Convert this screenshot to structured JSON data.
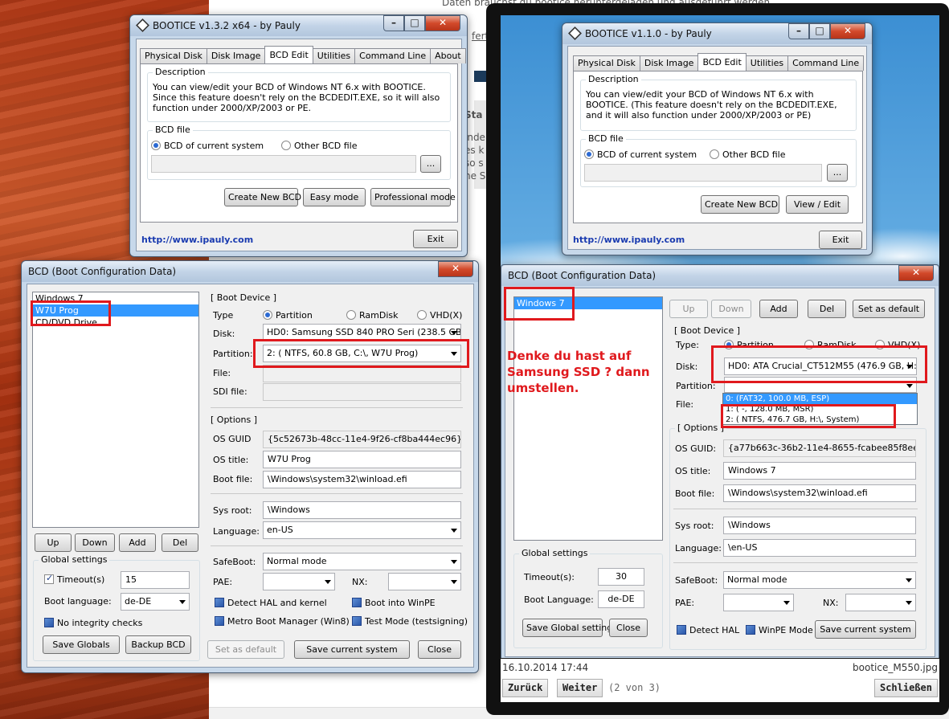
{
  "background": {
    "fragments": [
      "Daten brauchst du bootice heruntergeladen und ausgeführt werden",
      "fert",
      "Sta",
      "inde",
      "es k",
      "so s",
      "he S"
    ]
  },
  "bootice_left": {
    "title": "BOOTICE v1.3.2 x64 - by Pauly",
    "tabs": [
      "Physical Disk",
      "Disk Image",
      "BCD Edit",
      "Utilities",
      "Command Line",
      "About"
    ],
    "active_tab": "BCD Edit",
    "description_label": "Description",
    "description": "You can view/edit your BCD of Windows NT 6.x with BOOTICE. Since this feature doesn't rely on the BCDEDIT.EXE, so it will also function under 2000/XP/2003 or PE.",
    "bcd_file_label": "BCD file",
    "radio_current": "BCD of current system",
    "radio_other": "Other BCD file",
    "browse": "...",
    "buttons": [
      "Create New BCD",
      "Easy mode",
      "Professional mode"
    ],
    "link": "http://www.ipauly.com",
    "exit": "Exit"
  },
  "bcd_left": {
    "title": "BCD (Boot Configuration Data)",
    "entries": [
      "Windows 7",
      "W7U Prog",
      "CD/DVD Drive"
    ],
    "selected_entry": "W7U Prog",
    "list_buttons": [
      "Up",
      "Down",
      "Add",
      "Del"
    ],
    "global_label": "Global settings",
    "timeout_label": "Timeout(s)",
    "timeout_value": "15",
    "boot_language_label": "Boot language:",
    "boot_language_value": "de-DE",
    "no_integrity": "No integrity checks",
    "save_globals": "Save Globals",
    "backup_bcd": "Backup BCD",
    "boot_device_label": "[ Boot Device ]",
    "type_label": "Type",
    "type_partition": "Partition",
    "type_ramdisk": "RamDisk",
    "type_vhd": "VHD(X)",
    "disk_label": "Disk:",
    "disk_value": "HD0: Samsung SSD 840 PRO Seri (238.5 GB, C",
    "partition_label": "Partition:",
    "partition_value": "2: ( NTFS,  60.8 GB, C:\\, W7U Prog)",
    "file_label": "File:",
    "sdi_label": "SDI file:",
    "options_label": "[ Options ]",
    "os_guid_label": "OS GUID",
    "os_guid_value": "{5c52673b-48cc-11e4-9f26-cf8ba444ec96}",
    "os_title_label": "OS title:",
    "os_title_value": "W7U Prog",
    "boot_file_label": "Boot file:",
    "boot_file_value": "\\Windows\\system32\\winload.efi",
    "sys_root_label": "Sys root:",
    "sys_root_value": "\\Windows",
    "language_label": "Language:",
    "language_value": "en-US",
    "safeboot_label": "SafeBoot:",
    "safeboot_value": "Normal mode",
    "pae_label": "PAE:",
    "nx_label": "NX:",
    "detect_hal": "Detect HAL and kernel",
    "boot_winpe": "Boot into WinPE",
    "metro_boot": "Metro Boot Manager (Win8)",
    "test_mode": "Test Mode (testsigning)",
    "set_default": "Set as default",
    "save_current": "Save current system",
    "close": "Close"
  },
  "viewer": {
    "bootice_right": {
      "title": "BOOTICE v1.1.0 - by Pauly",
      "tabs": [
        "Physical Disk",
        "Disk Image",
        "BCD Edit",
        "Utilities",
        "Command Line"
      ],
      "active_tab": "BCD Edit",
      "description_label": "Description",
      "description": "You can view/edit your BCD of Windows NT 6.x with BOOTICE. (This feature doesn't rely on the BCDEDIT.EXE, and it will also function under 2000/XP/2003 or PE)",
      "bcd_file_label": "BCD file",
      "radio_current": "BCD of current system",
      "radio_other": "Other BCD file",
      "browse": "...",
      "buttons": [
        "Create New BCD",
        "View / Edit"
      ],
      "link": "http://www.ipauly.com",
      "exit": "Exit"
    },
    "bcd_right": {
      "title": "BCD (Boot Configuration Data)",
      "entries": [
        "Windows 7"
      ],
      "selected_entry": "Windows 7",
      "top_buttons": [
        "Up",
        "Down",
        "Add",
        "Del",
        "Set as default"
      ],
      "boot_device_label": "[ Boot Device ]",
      "type_label": "Type:",
      "type_partition": "Partition",
      "type_ramdisk": "RamDisk",
      "type_vhd": "VHD(X)",
      "disk_label": "Disk:",
      "disk_value": "HD0: ATA Crucial_CT512M55 (476.9 GB, H:)",
      "partition_label": "Partition:",
      "partition_options": [
        "0: (FAT32, 100.0 MB, ESP)",
        "1: ( -, 128.0 MB, MSR)",
        "2: ( NTFS, 476.7 GB, H:\\, System)"
      ],
      "file_label": "File:",
      "options_label": "[ Options ]",
      "os_guid_label": "OS GUID:",
      "os_guid_value": "{a77b663c-36b2-11e4-8655-fcabee85f8ee}",
      "os_title_label": "OS title:",
      "os_title_value": "Windows 7",
      "boot_file_label": "Boot file:",
      "boot_file_value": "\\Windows\\system32\\winload.efi",
      "sys_root_label": "Sys root:",
      "sys_root_value": "\\Windows",
      "language_label": "Language:",
      "language_value": "\\en-US",
      "safeboot_label": "SafeBoot:",
      "safeboot_value": "Normal mode",
      "pae_label": "PAE:",
      "nx_label": "NX:",
      "global_label": "Global settings",
      "timeout_label": "Timeout(s):",
      "timeout_value": "30",
      "boot_language_label": "Boot Language:",
      "boot_language_value": "de-DE",
      "save_global": "Save Global settings",
      "close": "Close",
      "detect_hal": "Detect HAL",
      "winpe_mode": "WinPE Mode",
      "save_current": "Save current system"
    },
    "annotation": "Denke du hast auf Samsung SSD ? dann umstellen.",
    "date": "16.10.2014 17:44",
    "filename": "bootice_M550.jpg",
    "back": "Zurück",
    "next": "Weiter",
    "counter": "(2 von 3)",
    "close": "Schließen"
  },
  "colors": {
    "accent": "#3399ff",
    "annotation": "#e0191d"
  }
}
